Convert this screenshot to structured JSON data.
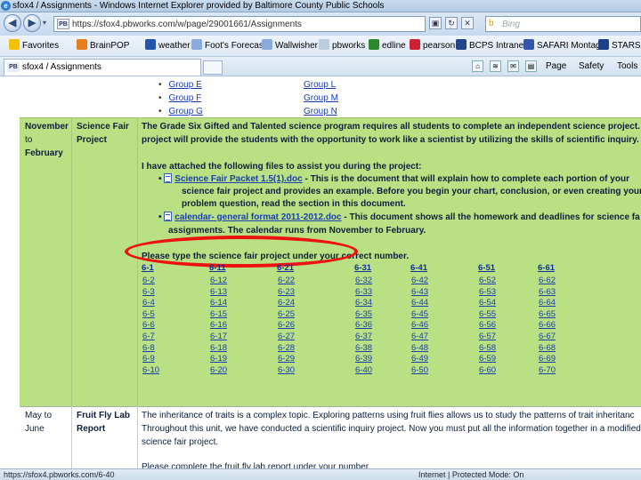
{
  "window": {
    "title": "sfox4 / Assignments - Windows Internet Explorer provided by Baltimore County Public Schools"
  },
  "address_bar": {
    "url": "https://sfox4.pbworks.com/w/page/29001661/Assignments",
    "search_placeholder": "Bing"
  },
  "favorites_bar": {
    "items": [
      "Favorites",
      "BrainPOP",
      "weather",
      "Foot's Forecast",
      "Wallwisher",
      "pbworks",
      "edline",
      "pearson",
      "BCPS Intranet",
      "SAFARI Montage",
      "STARS L"
    ]
  },
  "tabs": {
    "active_label": "sfox4 / Assignments"
  },
  "command_bar": {
    "page": "Page",
    "safety": "Safety",
    "tools": "Tools"
  },
  "groups": {
    "left": [
      "Group E",
      "Group F",
      "Group G"
    ],
    "right": [
      "Group L",
      "Group M",
      "Group N"
    ]
  },
  "science_fair_row": {
    "date_lines": [
      "November",
      "to",
      "February"
    ],
    "topic_lines": [
      "Science Fair",
      "Project"
    ],
    "intro_lines": [
      "The Grade Six Gifted and Talented science program requires all students to complete an independent science project. Thi",
      "project will provide the students with the opportunity to work like a scientist by utilizing the skills of scientific inquiry."
    ],
    "attached_line": "I have attached the following files to assist you during the project:",
    "file1": {
      "link": "Science Fair Packet 1.5(1).doc",
      "desc_lines": [
        " - This is the document that will explain how to complete each portion of your",
        "science fair project and provides an example.  Before you begin your chart, conclusion, or even creating your",
        "problem question, read the section in this document."
      ]
    },
    "file2": {
      "link": "calendar- general format 2011-2012.doc",
      "desc_lines": [
        "  - This document shows all the homework and deadlines for science fa",
        "assignments.  The calendar runs from November to February."
      ]
    },
    "type_prompt": "Please type the science fair project under your correct number.",
    "number_columns": [
      [
        "6-1",
        "6-2",
        "6-3",
        "6-4",
        "6-5",
        "6-6",
        "6-7",
        "6-8",
        "6-9",
        "6-10"
      ],
      [
        "6-11",
        "6-12",
        "6-13",
        "6-14",
        "6-15",
        "6-16",
        "6-17",
        "6-18",
        "6-19",
        "6-20"
      ],
      [
        "6-21",
        "6-22",
        "6-23",
        "6-24",
        "6-25",
        "6-26",
        "6-27",
        "6-28",
        "6-29",
        "6-30"
      ],
      [
        "6-31",
        "6-32",
        "6-33",
        "6-34",
        "6-35",
        "6-36",
        "6-37",
        "6-38",
        "6-39",
        "6-40"
      ],
      [
        "6-41",
        "6-42",
        "6-43",
        "6-44",
        "6-45",
        "6-46",
        "6-47",
        "6-48",
        "6-49",
        "6-50"
      ],
      [
        "6-51",
        "6-52",
        "6-53",
        "6-54",
        "6-55",
        "6-56",
        "6-57",
        "6-58",
        "6-59",
        "6-60"
      ],
      [
        "6-61",
        "6-62",
        "6-63",
        "6-64",
        "6-65",
        "6-66",
        "6-67",
        "6-68",
        "6-69",
        "6-70"
      ]
    ]
  },
  "fruit_fly_row": {
    "date_lines": [
      "May to",
      "June"
    ],
    "topic_lines": [
      "Fruit Fly Lab",
      "Report"
    ],
    "text_lines": [
      "The inheritance of traits is a complex topic.  Exploring patterns using fruit flies allows us to study the patterns of trait inheritanc",
      "Throughout this unit, we have conducted a scientific inquiry project.  Now you must put all the information together in a modified",
      "science fair project.",
      "",
      "Please complete the fruit fly lab report under your number."
    ]
  },
  "status_bar": {
    "url": "https://sfox4.pbworks.com/6-40",
    "zone": "Internet | Protected Mode: On"
  },
  "colors": {
    "row_highlight": "#b9e082",
    "annotation": "#e11111",
    "link": "#1a3eb0"
  }
}
